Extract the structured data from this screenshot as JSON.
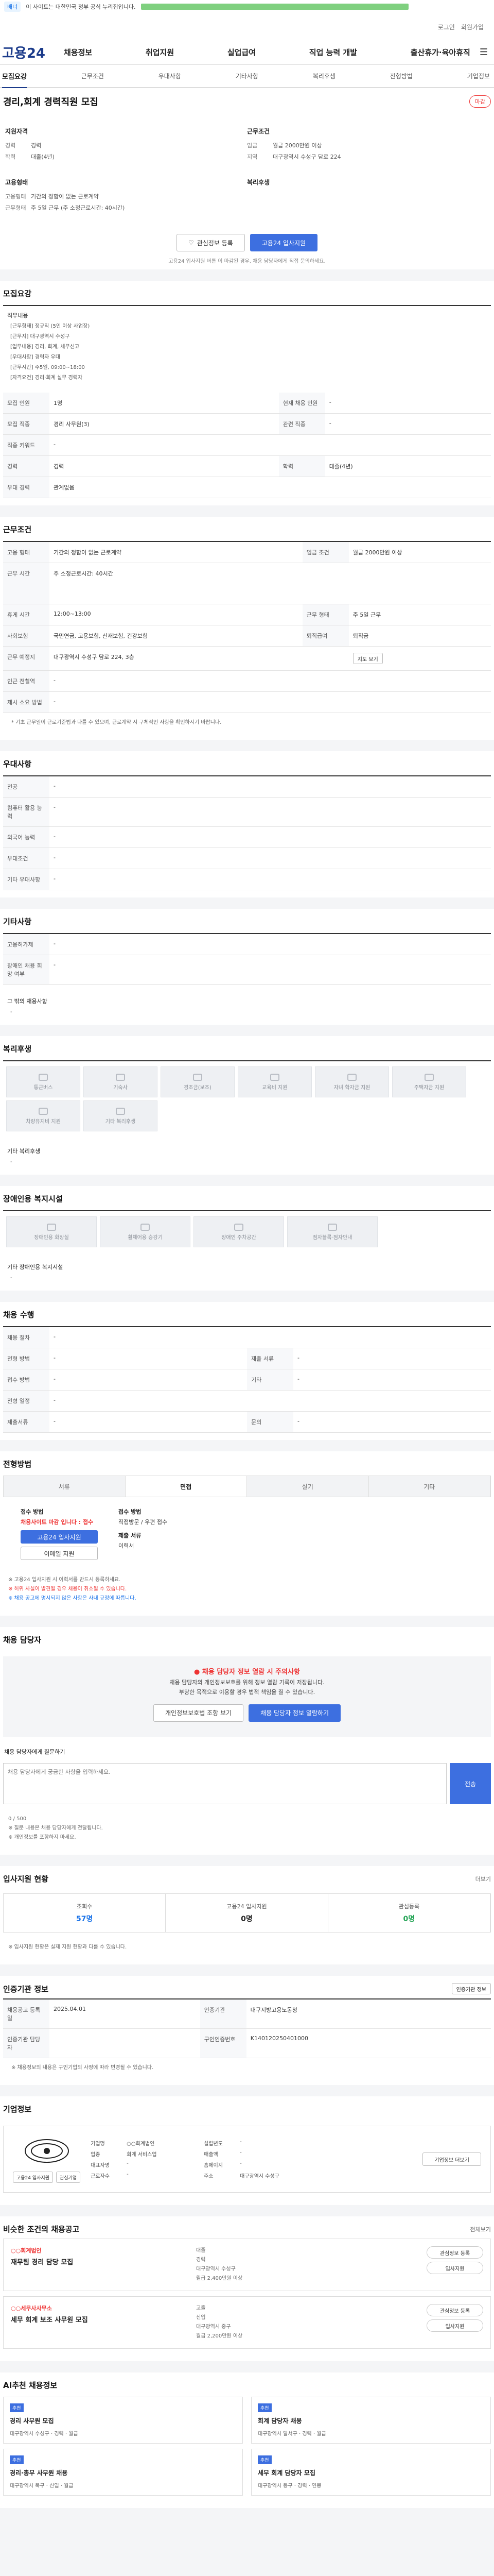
{
  "banner": {
    "tag": "배너",
    "text": "이 사이트는 대한민국 정부 공식 누리집입니다."
  },
  "util": {
    "login": "로그인",
    "join": "회원가입"
  },
  "gnb": {
    "logo": "고용24",
    "menus": [
      "채용정보",
      "취업지원",
      "실업급여",
      "직업 능력 개발",
      "출산휴가·육아휴직"
    ]
  },
  "subtabs": {
    "active": "모집요강",
    "items": [
      "근무조건",
      "우대사항",
      "기타사항",
      "복리후생",
      "전형방법",
      "기업정보"
    ]
  },
  "job": {
    "title": "경리,회계 경력직원 모집",
    "status": "마감",
    "summary_left_title": "지원자격",
    "summary_right_title": "근무조건",
    "left": [
      {
        "k": "경력",
        "v": "경력"
      },
      {
        "k": "학력",
        "v": "대졸(4년)"
      },
      {
        "k": "",
        "v": ""
      }
    ],
    "right": [
      {
        "k": "임금",
        "v": "월급 2000만원 이상"
      },
      {
        "k": "",
        "v": ""
      },
      {
        "k": "지역",
        "v": "대구광역시 수성구 담로 224"
      }
    ],
    "left2_title": "고용형태",
    "left2": [
      {
        "k": "고용형태",
        "v": "기간의 정함이 없는 근로계약"
      },
      {
        "k": "근무형태",
        "v": "주 5일 근무 (주 소정근로시간: 40시간)"
      }
    ],
    "right2_title": "복리후생",
    "btn_interest": "관심정보 등록",
    "btn_apply": "고용24 입사지원",
    "note": "고용24 입사지원 버튼 이 마감된 경우, 채용 담당자에게 직접 문의하세요."
  },
  "recruit": {
    "heading": "모집요강",
    "duty_title": "직무내용",
    "duty_lines": [
      "[근무형태] 정규직 (5인 이상 사업장)",
      "[근무지] 대구광역시 수성구",
      "[업무내용] 경리, 회계, 세무신고",
      "[우대사항] 경력자 우대",
      "[근무시간] 주5일, 09:00~18:00",
      "[자격요건] 경리·회계 실무 경력자"
    ],
    "rows": [
      {
        "k": "모집 인원",
        "v": "1명",
        "k2": "현재 채용 인원",
        "v2": "-"
      },
      {
        "k": "모집 직종",
        "v": "경리 사무원(3)",
        "k2": "관련 직종",
        "v2": "-"
      },
      {
        "k": "직종 키워드",
        "v": "-",
        "k2": "",
        "v2": ""
      },
      {
        "k": "경력",
        "v": "경력",
        "k2": "학력",
        "v2": "대졸(4년)"
      },
      {
        "k": "우대 경력",
        "v": "관계없음",
        "k2": "",
        "v2": ""
      }
    ]
  },
  "conditions": {
    "heading": "근무조건",
    "rows": [
      {
        "k": "고용 형태",
        "v": "기간의 정함이 없는 근로계약",
        "k2": "임금 조건",
        "v2": "월급 2000만원 이상"
      },
      {
        "k": "근무 시간",
        "v": "주 소정근로시간: 40시간",
        "k2": "",
        "v2": ""
      },
      {
        "k": "휴게 시간",
        "v": "12:00~13:00",
        "k2": "근무 형태",
        "v2": "주 5일 근무"
      },
      {
        "k": "사회보험",
        "v": "국민연금, 고용보험, 산재보험, 건강보험",
        "k2": "퇴직급여",
        "v2": "퇴직금"
      },
      {
        "k": "근무 예정지",
        "v": "대구광역시 수성구 담로 224, 3층",
        "k2": "",
        "v2": ""
      },
      {
        "k": "인근 전철역",
        "v": "-",
        "k2": "",
        "v2": ""
      },
      {
        "k": "제시 소요 방법",
        "v": "-",
        "k2": "",
        "v2": ""
      }
    ],
    "map_btn": "지도 보기",
    "footnote": "* 기초 근무일이 근로기준법과 다를 수 있으며, 근로계약 시 구체적인 사항을 확인하시기 바랍니다."
  },
  "prefer": {
    "heading": "우대사항",
    "rows": [
      {
        "k": "전공",
        "v": "-"
      },
      {
        "k": "컴퓨터 활용 능력",
        "v": "-"
      },
      {
        "k": "외국어 능력",
        "v": "-"
      },
      {
        "k": "우대조건",
        "v": "-"
      },
      {
        "k": "기타 우대사항",
        "v": "-"
      }
    ]
  },
  "etc": {
    "heading": "기타사항",
    "rows": [
      {
        "k": "고용허가제",
        "v": "-"
      },
      {
        "k": "장애인 채용 희망 여부",
        "v": "-"
      }
    ],
    "other_title": "그 밖의 채용사항",
    "other_value": "-"
  },
  "welfare": {
    "heading": "복리후생",
    "items": [
      "통근버스",
      "기숙사",
      "경조금(보조)",
      "교육비 지원",
      "자녀 학자금 지원",
      "주택자금 지원",
      "차량유지비 지원",
      "기타 복리후생",
      "",
      ""
    ],
    "other_title": "기타 복리후생",
    "other_value": "-"
  },
  "disabled": {
    "heading": "장애인용 복지시설",
    "items": [
      "장애인용 화장실",
      "휠체어용 승강기",
      "장애인 주차공간",
      "점자블록·점자안내"
    ],
    "other_title": "기타 장애인용 복지시설",
    "other_value": "-"
  },
  "screen": {
    "heading": "채용 수행",
    "rows": [
      {
        "k": "채용 절차",
        "v": "-",
        "k2": "",
        "v2": ""
      },
      {
        "k": "전형 방법",
        "v": "-",
        "k2": "제출 서류",
        "v2": "-"
      },
      {
        "k": "접수 방법",
        "v": "-",
        "k2": "기타",
        "v2": "-"
      },
      {
        "k": "전형 일정",
        "v": "-",
        "k2": "",
        "v2": ""
      },
      {
        "k": "제출서류",
        "v": "-",
        "k2": "문의",
        "v2": "-"
      }
    ]
  },
  "process": {
    "heading": "전형방법",
    "steps": [
      "서류",
      "면접",
      "실기",
      "기타"
    ],
    "p1_title": "접수 방법",
    "p1_hl": "채용사이트 마감 입니다 : 접수",
    "p1_btn1": "고용24 입사지원",
    "p1_btn2": "이메일 지원",
    "p2_title": "접수 방법",
    "p2_v": "직접방문 / 우편 접수",
    "p2_title2": "제출 서류",
    "p2_v2": "이력서",
    "bullets": [
      "※ 고용24 입사지원 시 이력서를 반드시 등록하세요.",
      "※ 허위 사실이 발견될 경우 채용이 취소될 수 있습니다.",
      "※ 채용 공고에 명시되지 않은 사항은 사내 규정에 따릅니다."
    ]
  },
  "contact": {
    "heading": "채용 담당자",
    "alert_title": "채용 담당자 정보 열람 시 주의사항",
    "alert_lines": [
      "채용 담당자의 개인정보보호를 위해 정보 열람 기록이 저장됩니다.",
      "부당한 목적으로 이용할 경우 법적 책임을 질 수 있습니다."
    ],
    "btn1": "개인정보보호법 조항 보기",
    "btn2": "채용 담당자 정보 열람하기",
    "inquiry_title": "채용 담당자에게 질문하기",
    "inquiry_placeholder": "채용 담당자에게 궁금한 사항을 입력하세요.",
    "send": "전송",
    "counter": "0 / 500",
    "notes": [
      "※ 질문 내용은 채용 담당자에게 전달됩니다.",
      "※ 개인정보를 포함하지 마세요."
    ]
  },
  "stats": {
    "heading": "입사지원 현황",
    "more": "더보기",
    "items": [
      {
        "k": "조회수",
        "v": "57명",
        "cls": ""
      },
      {
        "k": "고용24 입사지원",
        "v": "0명",
        "cls": "dark"
      },
      {
        "k": "관심등록",
        "v": "0명",
        "cls": "green"
      }
    ],
    "note": "※ 입사지원 현황은 실제 지원 현황과 다를 수 있습니다."
  },
  "info": {
    "heading": "인증기관 정보",
    "more": "인증기관 정보",
    "rows": [
      {
        "k": "채용공고 등록일",
        "v": "2025.04.01",
        "k2": "인증기관",
        "v2": "대구지방고용노동청",
        "k3": "",
        "v3": ""
      },
      {
        "k": "인증기관 담당자",
        "v": "",
        "k2": "구인인증번호",
        "v2": "K140120250401000",
        "k3": "",
        "v3": ""
      }
    ],
    "note": "※ 채용정보의 내용은 구인기업의 사정에 따라 변경될 수 있습니다."
  },
  "company": {
    "heading": "기업정보",
    "info": [
      {
        "k": "기업명",
        "v": "○○회계법인"
      },
      {
        "k": "업종",
        "v": "회계 서비스업"
      },
      {
        "k": "대표자명",
        "v": "-"
      },
      {
        "k": "근로자수",
        "v": "-"
      },
      {
        "k": "주소",
        "v": "대구광역시 수성구"
      },
      {
        "k": "설립년도",
        "v": "-"
      },
      {
        "k": "매출액",
        "v": "-"
      },
      {
        "k": "홈페이지",
        "v": "-"
      }
    ],
    "btn": "기업정보 더보기",
    "btn_apply": "고용24 입사지원",
    "btn_interest": "관심기업"
  },
  "recommend": {
    "heading": "비슷한 조건의 채용공고",
    "more": "전체보기",
    "items": [
      {
        "company": "○○회계법인",
        "title": "재무팀 경리 담당 모집",
        "meta": [
          "대졸",
          "경력",
          "대구광역시 수성구",
          "월급 2,400만원 이상"
        ]
      },
      {
        "company": "○○세무사사무소",
        "title": "세무 회계 보조 사무원 모집",
        "meta": [
          "고졸",
          "신입",
          "대구광역시 중구",
          "월급 2,200만원 이상"
        ]
      }
    ],
    "btn1": "관심정보 등록",
    "btn2": "입사지원"
  },
  "aiRec": {
    "heading": "AI추천 채용정보",
    "items": [
      {
        "tag": "추천",
        "title": "경리 사무원 모집",
        "meta": "대구광역시 수성구 · 경력 · 월급"
      },
      {
        "tag": "추천",
        "title": "회계 담당자 채용",
        "meta": "대구광역시 달서구 · 경력 · 월급"
      },
      {
        "tag": "추천",
        "title": "경리·총무 사무원 채용",
        "meta": "대구광역시 북구 · 신입 · 월급"
      },
      {
        "tag": "추천",
        "title": "세무 회계 담당자 모집",
        "meta": "대구광역시 동구 · 경력 · 연봉"
      }
    ]
  }
}
